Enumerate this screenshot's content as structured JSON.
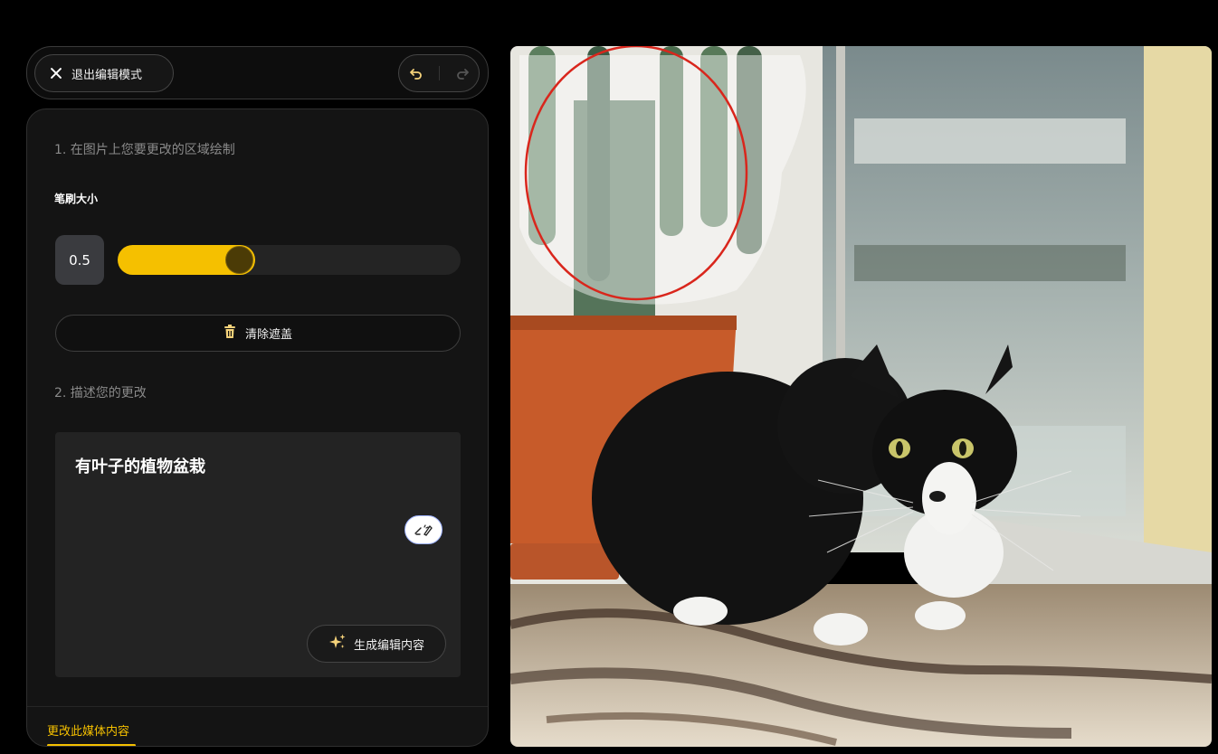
{
  "toolbar": {
    "exit_label": "退出编辑模式",
    "undo_icon": "undo-icon",
    "redo_icon": "redo-icon"
  },
  "panel": {
    "step1_title": "1. 在图片上您要更改的区域绘制",
    "brush_label": "笔刷大小",
    "brush_value": "0.5",
    "brush_fraction": 0.38,
    "clear_label": "清除遮盖",
    "step2_title": "2. 描述您的更改",
    "prompt_text": "有叶子的植物盆栽",
    "generate_label": "生成编辑内容",
    "tab_label": "更改此媒体内容"
  },
  "colors": {
    "accent": "#f5c000",
    "mask_outline": "#d9261c"
  },
  "image": {
    "description_icon": "photo-cat-cactus"
  }
}
